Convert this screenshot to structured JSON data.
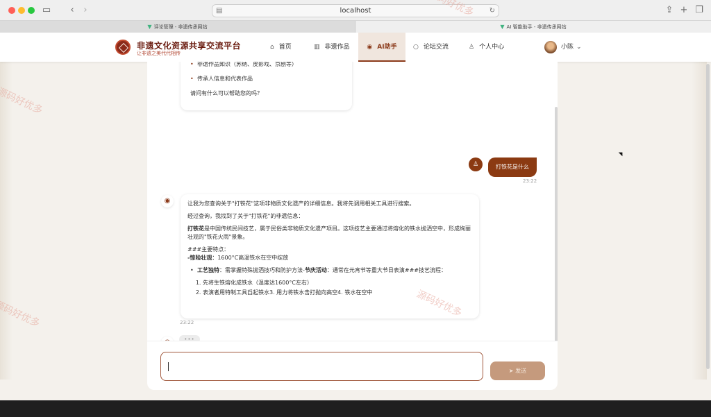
{
  "browser": {
    "address": "localhost",
    "tabs": [
      {
        "label": "评论管理 - 非遗传承网站"
      },
      {
        "label": "AI 智能助手 - 非遗传承网站"
      }
    ]
  },
  "header": {
    "brand_title": "非遗文化资源共享交流平台",
    "brand_subtitle": "让非遗之美代代相传",
    "nav": [
      {
        "label": "首页",
        "icon": "home-icon"
      },
      {
        "label": "非遗作品",
        "icon": "museum-icon"
      },
      {
        "label": "AI助手",
        "icon": "robot-icon",
        "active": true
      },
      {
        "label": "论坛交流",
        "icon": "chat-bubble-icon"
      },
      {
        "label": "个人中心",
        "icon": "user-icon"
      }
    ],
    "user_name": "小陈"
  },
  "chat": {
    "first_bot": {
      "items": [
        "非遗作品知识（苏绣、皮影戏、京剧等）",
        "传承人信息和代表作品"
      ],
      "question": "请问有什么可以帮助您的吗？"
    },
    "user_message": {
      "text": "打铁花是什么",
      "time": "23:22"
    },
    "bot_reply": {
      "line1": "让我为您查询关于\"打铁花\"这项非物质文化遗产的详细信息。我将先调用相关工具进行搜索。",
      "line2": "经过查询，我找到了关于\"打铁花\"的非遗信息：",
      "para_bold": "打铁花",
      "para_rest": "是中国传统民间技艺，属于民俗类非物质文化遗产项目。这项技艺主要通过将熔化的铁水抛洒空中，形成绚丽壮观的\"铁花火雨\"景象。",
      "section": "###主要特点：",
      "feat1_bold": "-惊险壮观",
      "feat1_rest": "：1600°C高温铁水在空中绽放",
      "feat2_bold": "工艺独特",
      "feat2_rest": "：需掌握特殊抛洒技巧和防护方法-",
      "feat3_bold": "节庆活动",
      "feat3_rest": "：通常在元宵节等重大节日表演###技艺流程：",
      "steps": [
        "先将生铁熔化成铁水（温度达1600°C左右）",
        "表演者用特制工具舀起铁水3. 用力将铁水击打抛向高空4. 铁水在空中"
      ],
      "time": "23:22"
    },
    "typing": "•••"
  },
  "input": {
    "placeholder": "",
    "send_label": "发送"
  },
  "watermark": "源码好优多"
}
